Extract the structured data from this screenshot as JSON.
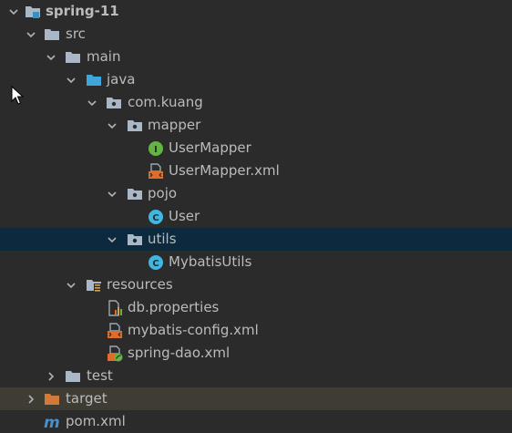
{
  "tree": {
    "items": [
      {
        "label": "spring-11",
        "icon": "module-folder-icon",
        "expanded": true
      },
      {
        "label": "src",
        "icon": "folder-icon",
        "expanded": true
      },
      {
        "label": "main",
        "icon": "folder-icon",
        "expanded": true
      },
      {
        "label": "java",
        "icon": "source-root-folder-icon",
        "expanded": true
      },
      {
        "label": "com.kuang",
        "icon": "package-icon",
        "expanded": true
      },
      {
        "label": "mapper",
        "icon": "package-icon",
        "expanded": true
      },
      {
        "label": "UserMapper",
        "icon": "interface-icon"
      },
      {
        "label": "UserMapper.xml",
        "icon": "xml-file-icon"
      },
      {
        "label": "pojo",
        "icon": "package-icon",
        "expanded": true
      },
      {
        "label": "User",
        "icon": "class-icon"
      },
      {
        "label": "utils",
        "icon": "package-icon",
        "expanded": true,
        "selected": true
      },
      {
        "label": "MybatisUtils",
        "icon": "class-icon"
      },
      {
        "label": "resources",
        "icon": "resources-folder-icon",
        "expanded": true
      },
      {
        "label": "db.properties",
        "icon": "properties-file-icon"
      },
      {
        "label": "mybatis-config.xml",
        "icon": "xml-file-icon"
      },
      {
        "label": "spring-dao.xml",
        "icon": "spring-xml-file-icon"
      },
      {
        "label": "test",
        "icon": "folder-icon",
        "expanded": false
      },
      {
        "label": "target",
        "icon": "excluded-folder-icon",
        "expanded": false
      },
      {
        "label": "pom.xml",
        "icon": "maven-icon"
      }
    ]
  },
  "colors": {
    "background": "#2b2b2b",
    "selected_row": "#0d293e",
    "excluded_row": "#3f3c34",
    "text": "#bbbbbb",
    "excluded_text": "#d28445",
    "folder": "#a9b7c6",
    "source_folder": "#40a5d8",
    "interface_icon": "#62b543",
    "class_icon": "#40b6e0"
  }
}
